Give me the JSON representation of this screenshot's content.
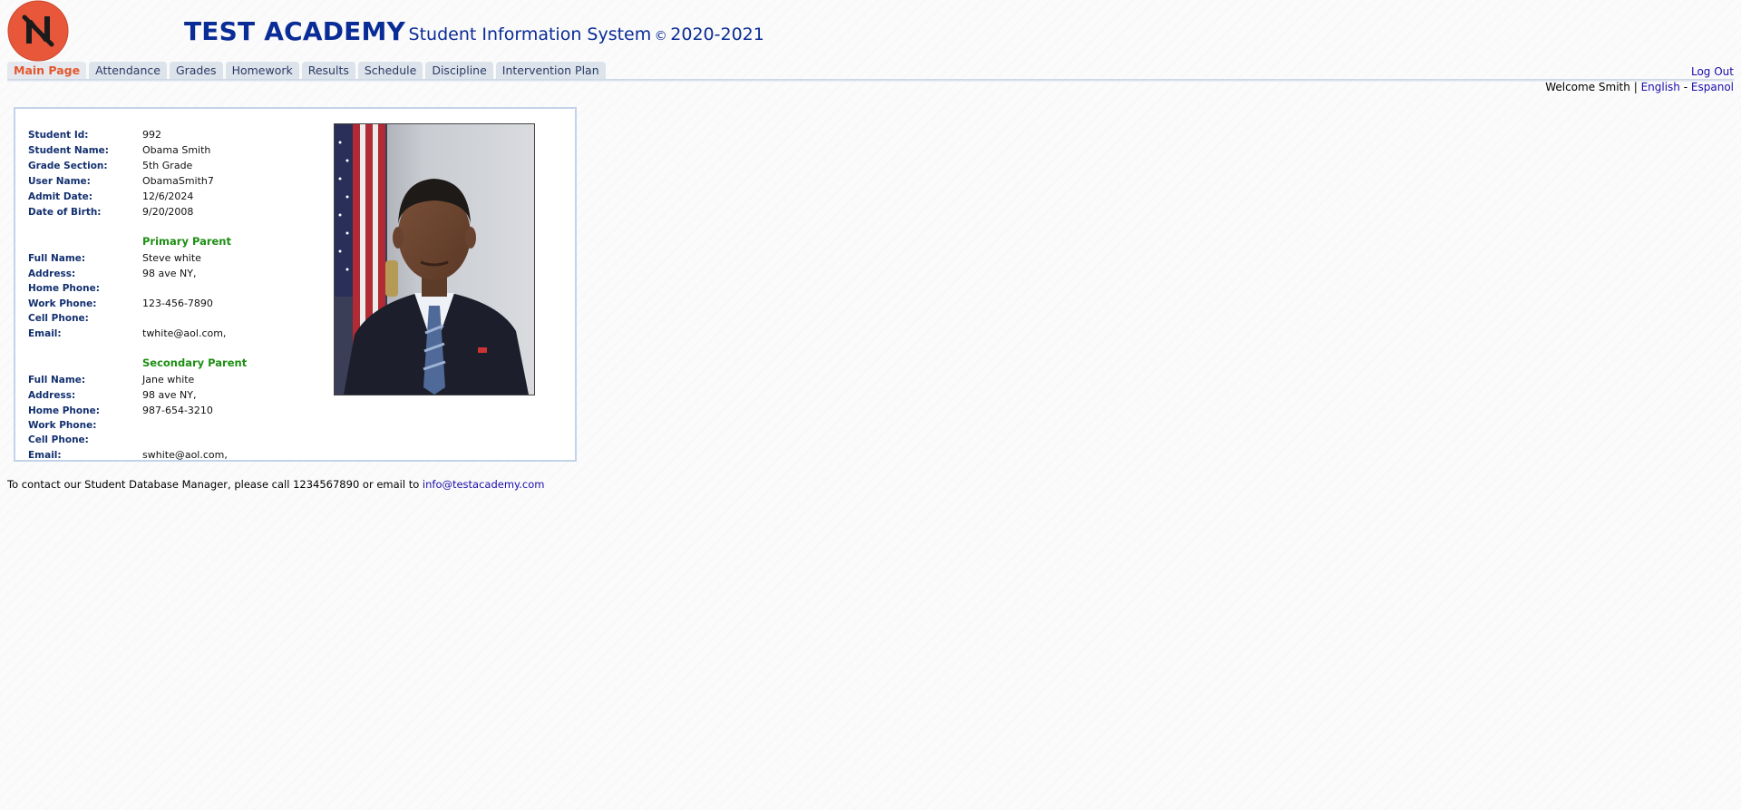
{
  "header": {
    "title_main": "TEST ACADEMY",
    "title_sub": "Student Information System",
    "copyright_symbol": "©",
    "year_range": "2020-2021",
    "logo_icon": "school-logo-n-icon",
    "logo_color": "#e8573a"
  },
  "nav": {
    "tabs": [
      {
        "label": "Main Page",
        "active": true
      },
      {
        "label": "Attendance"
      },
      {
        "label": "Grades"
      },
      {
        "label": "Homework"
      },
      {
        "label": "Results"
      },
      {
        "label": "Schedule"
      },
      {
        "label": "Discipline"
      },
      {
        "label": "Intervention Plan"
      }
    ],
    "logout": "Log Out",
    "welcome": "Welcome Smith",
    "separator": "|",
    "lang_english": "English",
    "lang_dash": "-",
    "lang_espanol": "Espanol"
  },
  "student": {
    "id_label": "Student Id:",
    "id": "992",
    "name_label": "Student Name:",
    "name": "Obama Smith",
    "grade_label": "Grade Section:",
    "grade": "5th Grade",
    "user_label": "User Name:",
    "user": "ObamaSmith7",
    "admit_label": "Admit Date:",
    "admit": "12/6/2024",
    "dob_label": "Date of Birth:",
    "dob": "9/20/2008",
    "photo_icon": "student-portrait-photo"
  },
  "primary_parent": {
    "heading": "Primary Parent",
    "full_name_label": "Full Name:",
    "full_name": "Steve white",
    "address_label": "Address:",
    "address": "98 ave NY,",
    "home_phone_label": "Home Phone:",
    "home_phone": "",
    "work_phone_label": "Work Phone:",
    "work_phone": "123-456-7890",
    "cell_phone_label": "Cell Phone:",
    "cell_phone": "",
    "email_label": "Email:",
    "email": "twhite@aol.com,"
  },
  "secondary_parent": {
    "heading": "Secondary Parent",
    "full_name_label": "Full Name:",
    "full_name": "Jane white",
    "address_label": "Address:",
    "address": "98 ave NY,",
    "home_phone_label": "Home Phone:",
    "home_phone": "987-654-3210",
    "work_phone_label": "Work Phone:",
    "work_phone": "",
    "cell_phone_label": "Cell Phone:",
    "cell_phone": "",
    "email_label": "Email:",
    "email": "swhite@aol.com,"
  },
  "footer": {
    "contact_text": "To contact our Student Database Manager, please call 1234567890 or email to",
    "contact_email": "info@testacademy.com"
  }
}
